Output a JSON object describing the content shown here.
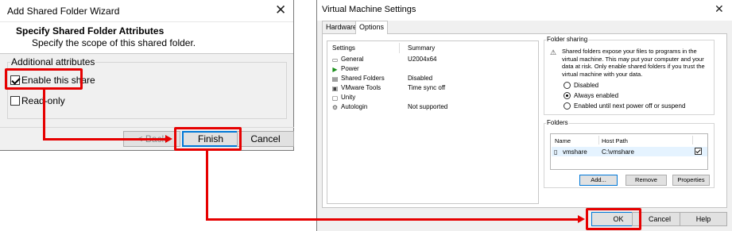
{
  "wizard": {
    "title": "Add Shared Folder Wizard",
    "heading": "Specify Shared Folder Attributes",
    "subheading": "Specify the scope of this shared folder.",
    "group_label": "Additional attributes",
    "enable_label": "Enable this share",
    "enable_checked": true,
    "readonly_label": "Read-only",
    "readonly_checked": false,
    "back_label": "< Back",
    "finish_label": "Finish",
    "cancel_label": "Cancel",
    "close_glyph": "✕"
  },
  "vm_settings": {
    "title": "Virtual Machine Settings",
    "close_glyph": "✕",
    "tabs": [
      "Hardware",
      "Options"
    ],
    "active_tab": "Options",
    "list_headers": [
      "Settings",
      "Summary"
    ],
    "settings_rows": [
      {
        "icon": "general-icon",
        "glyph": "▭",
        "name": "General",
        "summary": "U2004x64"
      },
      {
        "icon": "power-icon",
        "glyph": "▶",
        "name": "Power",
        "summary": ""
      },
      {
        "icon": "shared-folders-icon",
        "glyph": "▤",
        "name": "Shared Folders",
        "summary": "Disabled"
      },
      {
        "icon": "vmware-tools-icon",
        "glyph": "▣",
        "name": "VMware Tools",
        "summary": "Time sync off"
      },
      {
        "icon": "unity-icon",
        "glyph": "▢",
        "name": "Unity",
        "summary": ""
      },
      {
        "icon": "autologin-icon",
        "glyph": "⚙",
        "name": "Autologin",
        "summary": "Not supported"
      }
    ],
    "folder_sharing": {
      "label": "Folder sharing",
      "warning": "Shared folders expose your files to programs in the virtual machine. This may put your computer and your data at risk. Only enable shared folders if you trust the virtual machine with your data.",
      "options": [
        "Disabled",
        "Always enabled",
        "Enabled until next power off or suspend"
      ],
      "selected": "Always enabled"
    },
    "folders": {
      "label": "Folders",
      "headers": [
        "Name",
        "Host Path"
      ],
      "rows": [
        {
          "name": "vmshare",
          "path": "C:\\vmshare",
          "checked": true
        }
      ],
      "add_label": "Add...",
      "remove_label": "Remove",
      "properties_label": "Properties"
    },
    "ok_label": "OK",
    "cancel_label": "Cancel",
    "help_label": "Help"
  },
  "colors": {
    "annotation": "#e60000",
    "focus": "#0078d7",
    "dialog_bg": "#f0f0f0"
  }
}
